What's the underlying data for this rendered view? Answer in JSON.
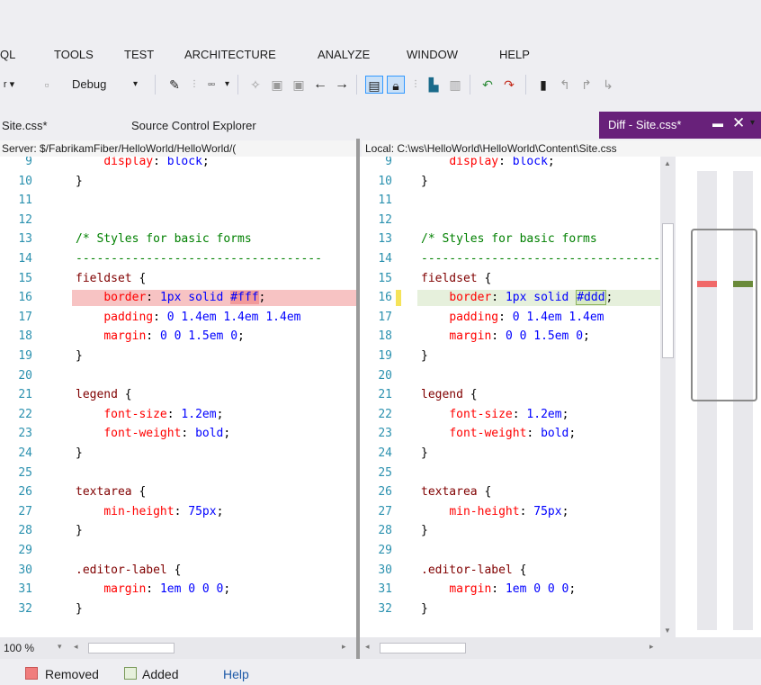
{
  "menu": [
    {
      "label": "QL"
    },
    {
      "label": "TOOLS"
    },
    {
      "label": "TEST"
    },
    {
      "label": "ARCHITECTURE"
    },
    {
      "label": "ANALYZE"
    },
    {
      "label": "WINDOW"
    },
    {
      "label": "HELP"
    }
  ],
  "toolbar": {
    "config_value": "Debug",
    "icons": [
      "dropdown-arrow-icon",
      "back-arrow-icon",
      "forward-arrow-icon",
      "diff-view-icon",
      "lock-icon",
      "bookmark-icon"
    ]
  },
  "tabs": {
    "items": [
      {
        "label": "Site.css*"
      },
      {
        "label": "Source Control Explorer"
      }
    ],
    "active": {
      "label": "Diff - Site.css*"
    }
  },
  "left_pane": {
    "header": "Server: $/FabrikamFiber/HelloWorld/HelloWorld/(",
    "lines": [
      {
        "num": "9",
        "parts": [
          [
            "    ",
            "txt"
          ],
          [
            "display",
            "prop"
          ],
          [
            ": ",
            "txt"
          ],
          [
            "block",
            "val"
          ],
          [
            ";",
            "txt"
          ]
        ]
      },
      {
        "num": "10",
        "parts": [
          [
            "}",
            "txt"
          ]
        ]
      },
      {
        "num": "11",
        "parts": []
      },
      {
        "num": "12",
        "parts": []
      },
      {
        "num": "13",
        "parts": [
          [
            "/* Styles for basic forms",
            "cmt"
          ]
        ]
      },
      {
        "num": "14",
        "parts": [
          [
            "-----------------------------------",
            "cmt"
          ]
        ]
      },
      {
        "num": "15",
        "parts": [
          [
            "fieldset",
            "sel"
          ],
          [
            " {",
            "txt"
          ]
        ]
      },
      {
        "num": "16",
        "parts": [
          [
            "    ",
            "txt"
          ],
          [
            "border",
            "prop"
          ],
          [
            ": ",
            "txt"
          ],
          [
            "1px solid ",
            "val"
          ],
          [
            "#fff",
            "valmark"
          ],
          [
            ";",
            "txt"
          ]
        ],
        "state": "removed"
      },
      {
        "num": "17",
        "parts": [
          [
            "    ",
            "txt"
          ],
          [
            "padding",
            "prop"
          ],
          [
            ": ",
            "txt"
          ],
          [
            "0 1.4em 1.4em 1.4em",
            "val"
          ]
        ]
      },
      {
        "num": "18",
        "parts": [
          [
            "    ",
            "txt"
          ],
          [
            "margin",
            "prop"
          ],
          [
            ": ",
            "txt"
          ],
          [
            "0 0 1.5em 0",
            "val"
          ],
          [
            ";",
            "txt"
          ]
        ]
      },
      {
        "num": "19",
        "parts": [
          [
            "}",
            "txt"
          ]
        ]
      },
      {
        "num": "20",
        "parts": []
      },
      {
        "num": "21",
        "parts": [
          [
            "legend",
            "sel"
          ],
          [
            " {",
            "txt"
          ]
        ]
      },
      {
        "num": "22",
        "parts": [
          [
            "    ",
            "txt"
          ],
          [
            "font-size",
            "prop"
          ],
          [
            ": ",
            "txt"
          ],
          [
            "1.2em",
            "val"
          ],
          [
            ";",
            "txt"
          ]
        ]
      },
      {
        "num": "23",
        "parts": [
          [
            "    ",
            "txt"
          ],
          [
            "font-weight",
            "prop"
          ],
          [
            ": ",
            "txt"
          ],
          [
            "bold",
            "val"
          ],
          [
            ";",
            "txt"
          ]
        ]
      },
      {
        "num": "24",
        "parts": [
          [
            "}",
            "txt"
          ]
        ]
      },
      {
        "num": "25",
        "parts": []
      },
      {
        "num": "26",
        "parts": [
          [
            "textarea",
            "sel"
          ],
          [
            " {",
            "txt"
          ]
        ]
      },
      {
        "num": "27",
        "parts": [
          [
            "    ",
            "txt"
          ],
          [
            "min-height",
            "prop"
          ],
          [
            ": ",
            "txt"
          ],
          [
            "75px",
            "val"
          ],
          [
            ";",
            "txt"
          ]
        ]
      },
      {
        "num": "28",
        "parts": [
          [
            "}",
            "txt"
          ]
        ]
      },
      {
        "num": "29",
        "parts": []
      },
      {
        "num": "30",
        "parts": [
          [
            ".editor-label",
            "sel"
          ],
          [
            " {",
            "txt"
          ]
        ]
      },
      {
        "num": "31",
        "parts": [
          [
            "    ",
            "txt"
          ],
          [
            "margin",
            "prop"
          ],
          [
            ": ",
            "txt"
          ],
          [
            "1em 0 0 0",
            "val"
          ],
          [
            ";",
            "txt"
          ]
        ]
      },
      {
        "num": "32",
        "parts": [
          [
            "}",
            "txt"
          ]
        ]
      }
    ]
  },
  "right_pane": {
    "header": "Local: C:\\ws\\HelloWorld\\HelloWorld\\Content\\Site.css",
    "lines": [
      {
        "num": "9",
        "parts": [
          [
            "    ",
            "txt"
          ],
          [
            "display",
            "prop"
          ],
          [
            ": ",
            "txt"
          ],
          [
            "block",
            "val"
          ],
          [
            ";",
            "txt"
          ]
        ]
      },
      {
        "num": "10",
        "parts": [
          [
            "}",
            "txt"
          ]
        ]
      },
      {
        "num": "11",
        "parts": []
      },
      {
        "num": "12",
        "parts": []
      },
      {
        "num": "13",
        "parts": [
          [
            "/* Styles for basic forms",
            "cmt"
          ]
        ]
      },
      {
        "num": "14",
        "parts": [
          [
            "-----------------------------------",
            "cmt"
          ]
        ]
      },
      {
        "num": "15",
        "parts": [
          [
            "fieldset",
            "sel"
          ],
          [
            " {",
            "txt"
          ]
        ]
      },
      {
        "num": "16",
        "parts": [
          [
            "    ",
            "txt"
          ],
          [
            "border",
            "prop"
          ],
          [
            ": ",
            "txt"
          ],
          [
            "1px solid ",
            "val"
          ],
          [
            "#ddd",
            "valadd"
          ],
          [
            ";",
            "txt"
          ]
        ],
        "state": "added"
      },
      {
        "num": "17",
        "parts": [
          [
            "    ",
            "txt"
          ],
          [
            "padding",
            "prop"
          ],
          [
            ": ",
            "txt"
          ],
          [
            "0 1.4em 1.4em",
            "val"
          ]
        ]
      },
      {
        "num": "18",
        "parts": [
          [
            "    ",
            "txt"
          ],
          [
            "margin",
            "prop"
          ],
          [
            ": ",
            "txt"
          ],
          [
            "0 0 1.5em 0",
            "val"
          ],
          [
            ";",
            "txt"
          ]
        ]
      },
      {
        "num": "19",
        "parts": [
          [
            "}",
            "txt"
          ]
        ]
      },
      {
        "num": "20",
        "parts": []
      },
      {
        "num": "21",
        "parts": [
          [
            "legend",
            "sel"
          ],
          [
            " {",
            "txt"
          ]
        ]
      },
      {
        "num": "22",
        "parts": [
          [
            "    ",
            "txt"
          ],
          [
            "font-size",
            "prop"
          ],
          [
            ": ",
            "txt"
          ],
          [
            "1.2em",
            "val"
          ],
          [
            ";",
            "txt"
          ]
        ]
      },
      {
        "num": "23",
        "parts": [
          [
            "    ",
            "txt"
          ],
          [
            "font-weight",
            "prop"
          ],
          [
            ": ",
            "txt"
          ],
          [
            "bold",
            "val"
          ],
          [
            ";",
            "txt"
          ]
        ]
      },
      {
        "num": "24",
        "parts": [
          [
            "}",
            "txt"
          ]
        ]
      },
      {
        "num": "25",
        "parts": []
      },
      {
        "num": "26",
        "parts": [
          [
            "textarea",
            "sel"
          ],
          [
            " {",
            "txt"
          ]
        ]
      },
      {
        "num": "27",
        "parts": [
          [
            "    ",
            "txt"
          ],
          [
            "min-height",
            "prop"
          ],
          [
            ": ",
            "txt"
          ],
          [
            "75px",
            "val"
          ],
          [
            ";",
            "txt"
          ]
        ]
      },
      {
        "num": "28",
        "parts": [
          [
            "}",
            "txt"
          ]
        ]
      },
      {
        "num": "29",
        "parts": []
      },
      {
        "num": "30",
        "parts": [
          [
            ".editor-label",
            "sel"
          ],
          [
            " {",
            "txt"
          ]
        ]
      },
      {
        "num": "31",
        "parts": [
          [
            "    ",
            "txt"
          ],
          [
            "margin",
            "prop"
          ],
          [
            ": ",
            "txt"
          ],
          [
            "1em 0 0 0",
            "val"
          ],
          [
            ";",
            "txt"
          ]
        ]
      },
      {
        "num": "32",
        "parts": [
          [
            "}",
            "txt"
          ]
        ]
      }
    ]
  },
  "status": {
    "zoom": "100 %"
  },
  "legend": {
    "removed": "Removed",
    "added": "Added",
    "help": "Help"
  },
  "colors": {
    "removed": "#f7c3c3",
    "added": "#e6f0dc",
    "active_tab": "#68217a",
    "overview_removed": "#f06868",
    "overview_added": "#6a8a3a"
  }
}
